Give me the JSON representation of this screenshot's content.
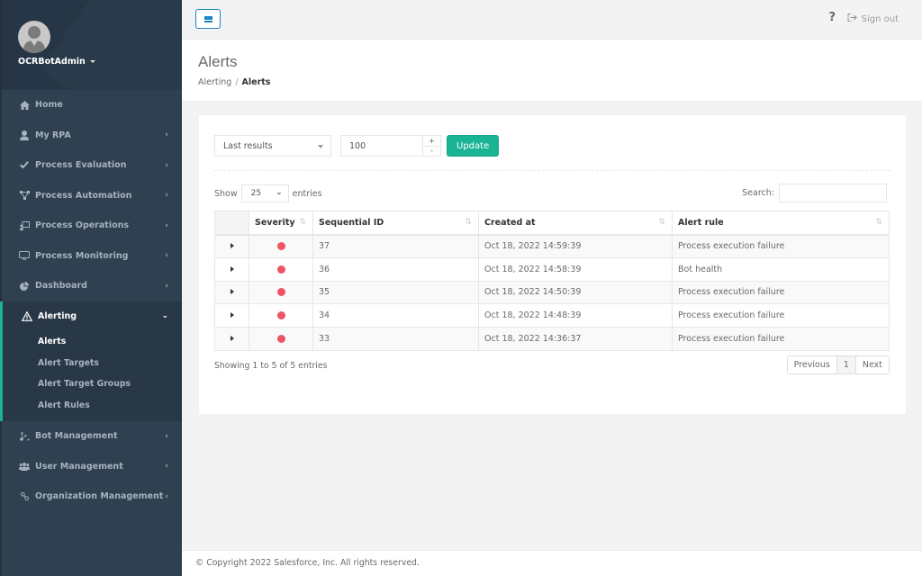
{
  "sidebar": {
    "username": "OCRBotAdmin",
    "items": [
      {
        "label": "Home",
        "icon": "home-icon",
        "chevron": false
      },
      {
        "label": "My RPA",
        "icon": "user-icon",
        "chevron": true
      },
      {
        "label": "Process Evaluation",
        "icon": "check-icon",
        "chevron": true
      },
      {
        "label": "Process Automation",
        "icon": "sitemap-icon",
        "chevron": true
      },
      {
        "label": "Process Operations",
        "icon": "operations-icon",
        "chevron": true
      },
      {
        "label": "Process Monitoring",
        "icon": "monitor-icon",
        "chevron": true
      },
      {
        "label": "Dashboard",
        "icon": "pie-chart-icon",
        "chevron": true
      }
    ],
    "active_group": {
      "label": "Alerting",
      "icon": "warning-icon",
      "children": [
        "Alerts",
        "Alert Targets",
        "Alert Target Groups",
        "Alert Rules"
      ],
      "current": "Alerts"
    },
    "items_after": [
      {
        "label": "Bot Management",
        "icon": "bot-icon",
        "chevron": true
      },
      {
        "label": "User Management",
        "icon": "users-icon",
        "chevron": true
      },
      {
        "label": "Organization Management",
        "icon": "link-icon",
        "chevron": true
      }
    ]
  },
  "topbar": {
    "help_label": "?",
    "signout_label": "Sign out"
  },
  "heading": {
    "title": "Alerts",
    "breadcrumb": [
      "Alerting",
      "Alerts"
    ]
  },
  "filters": {
    "mode_selected": "Last results",
    "count_value": "100",
    "increment_label": "+",
    "decrement_label": "-",
    "update_label": "Update"
  },
  "table_controls": {
    "show_label": "Show",
    "page_length": "25",
    "entries_label": "entries",
    "search_label": "Search:",
    "search_value": ""
  },
  "table": {
    "columns": [
      "",
      "Severity",
      "Sequential ID",
      "Created at",
      "Alert rule"
    ],
    "rows": [
      {
        "severity": "critical",
        "severity_color": "#ed5565",
        "id": "37",
        "created": "Oct 18, 2022 14:59:39",
        "rule": "Process execution failure"
      },
      {
        "severity": "critical",
        "severity_color": "#ed5565",
        "id": "36",
        "created": "Oct 18, 2022 14:58:39",
        "rule": "Bot health"
      },
      {
        "severity": "critical",
        "severity_color": "#ed5565",
        "id": "35",
        "created": "Oct 18, 2022 14:50:39",
        "rule": "Process execution failure"
      },
      {
        "severity": "critical",
        "severity_color": "#ed5565",
        "id": "34",
        "created": "Oct 18, 2022 14:48:39",
        "rule": "Process execution failure"
      },
      {
        "severity": "critical",
        "severity_color": "#ed5565",
        "id": "33",
        "created": "Oct 18, 2022 14:36:37",
        "rule": "Process execution failure"
      }
    ]
  },
  "pagination": {
    "info": "Showing 1 to 5 of 5 entries",
    "previous_label": "Previous",
    "current_page": "1",
    "next_label": "Next"
  },
  "footer": {
    "copyright": "© Copyright 2022 Salesforce, Inc. All rights reserved."
  },
  "colors": {
    "accent": "#1ab394",
    "sidebar_bg": "#2f4050",
    "primary_blue": "#1c84c6",
    "severity_critical": "#ed5565"
  }
}
